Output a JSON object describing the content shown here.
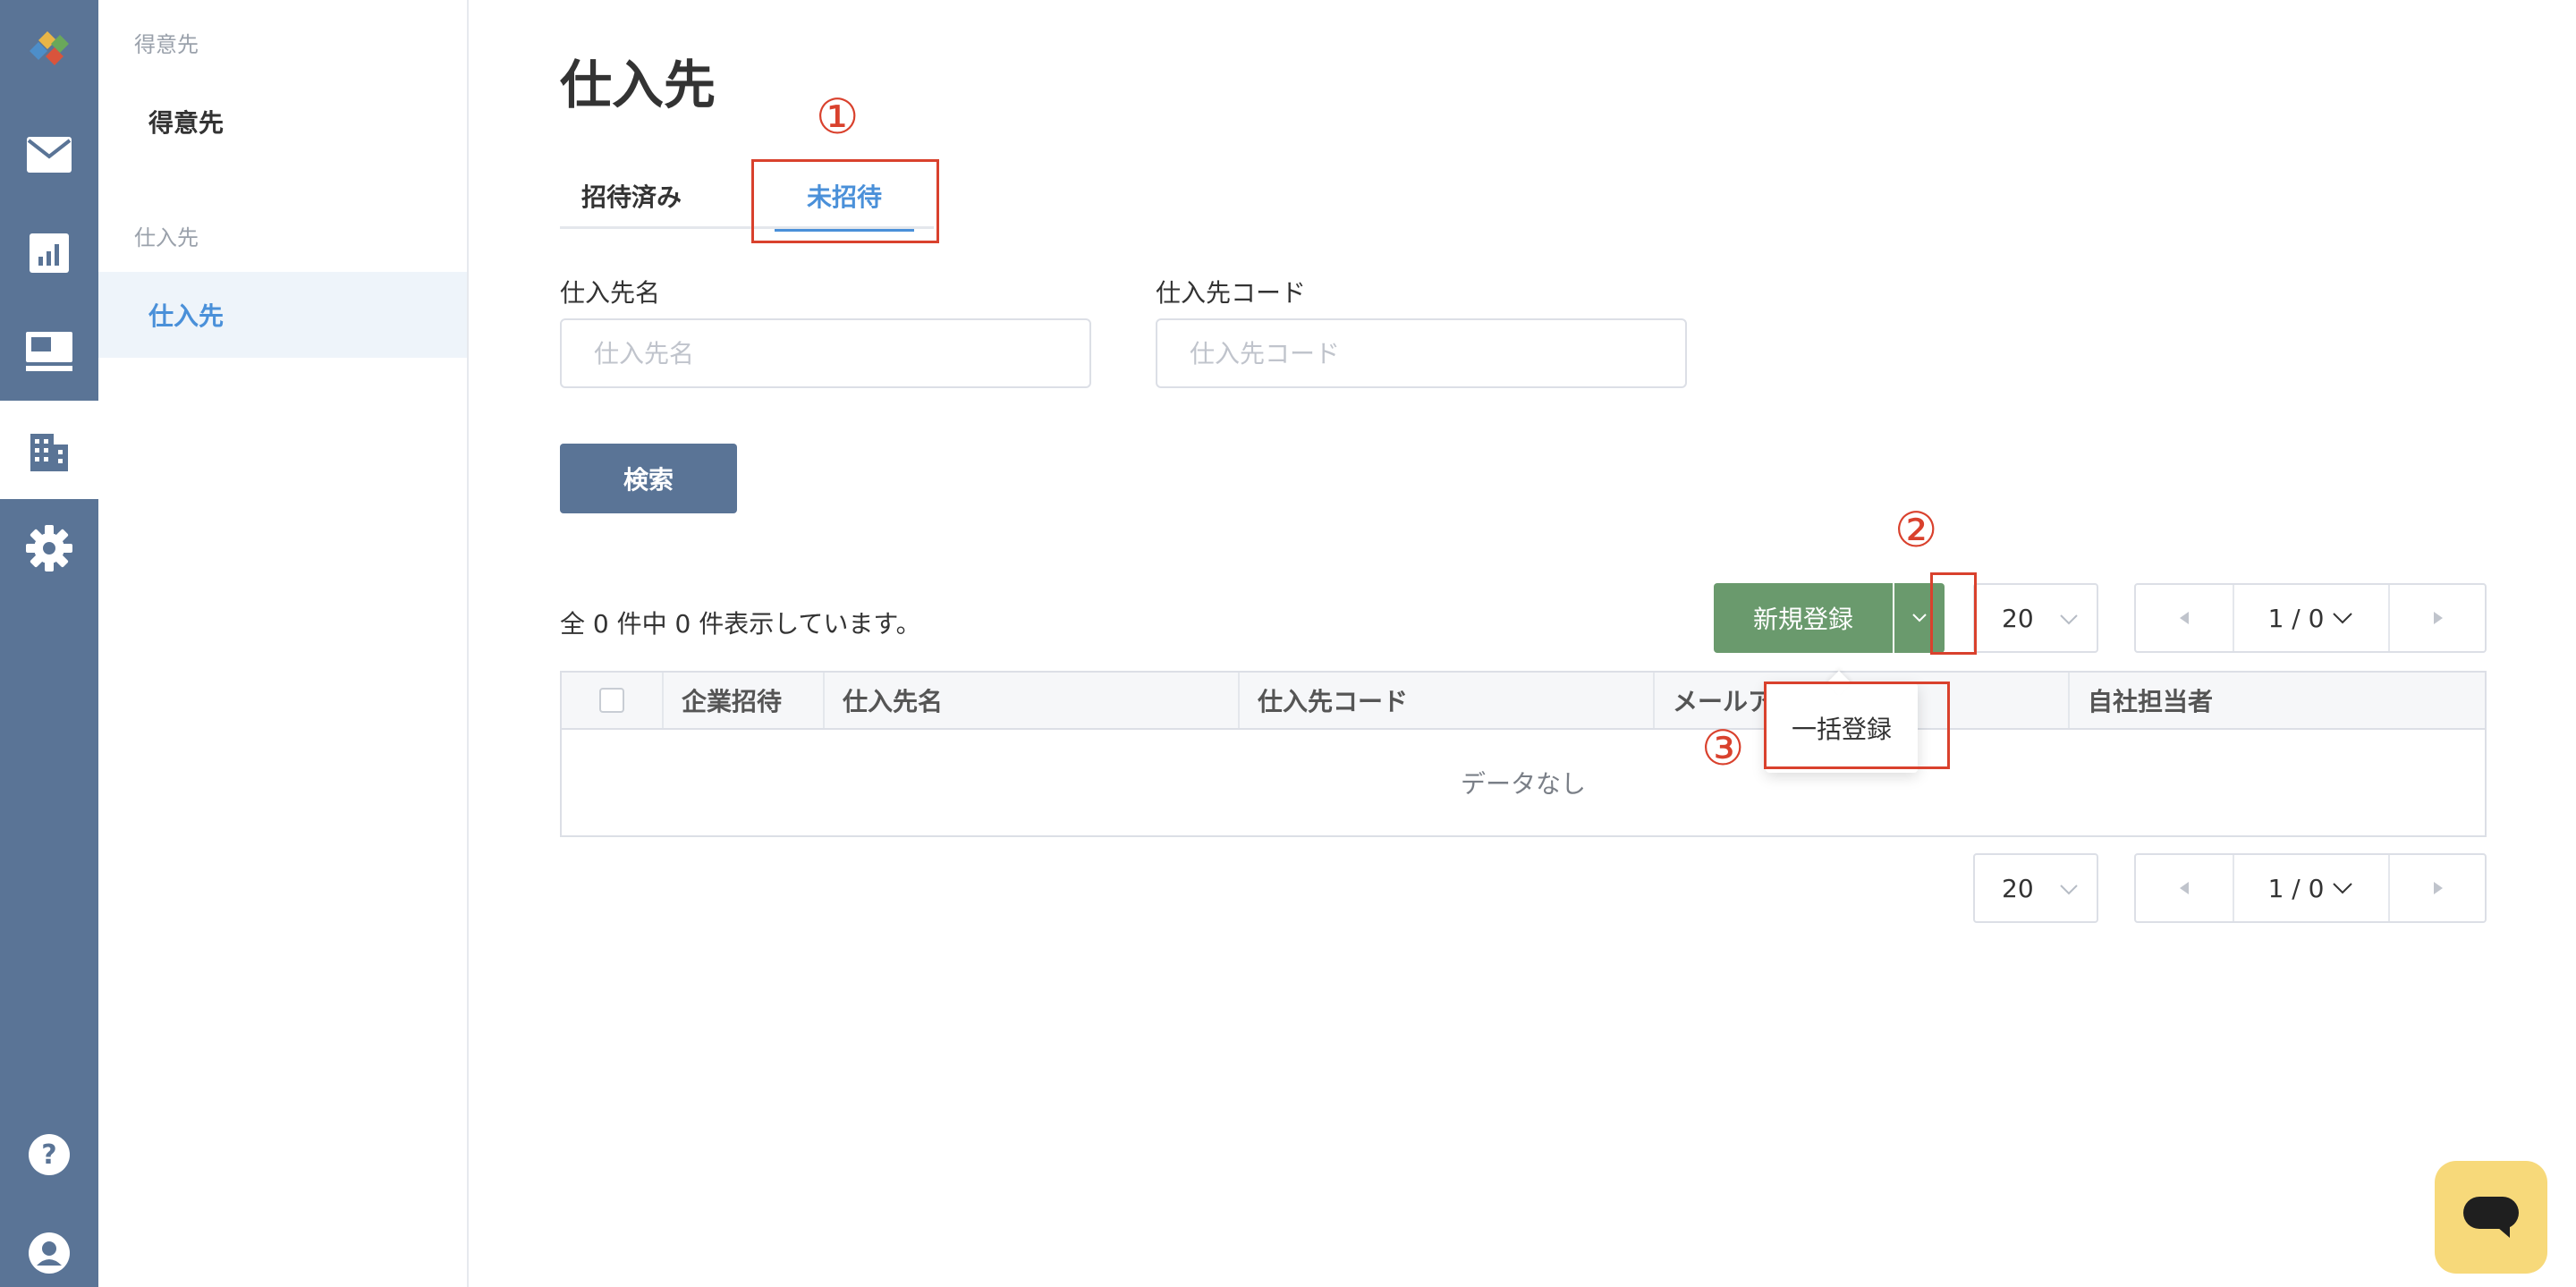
{
  "rail": {
    "items": [
      {
        "icon": "logo-icon"
      },
      {
        "icon": "mail-icon"
      },
      {
        "icon": "chart-icon"
      },
      {
        "icon": "invoice-icon"
      },
      {
        "icon": "building-icon",
        "active": true
      },
      {
        "icon": "gear-icon"
      },
      {
        "icon": "help-icon"
      },
      {
        "icon": "user-icon"
      }
    ]
  },
  "sidebar": {
    "group1": "得意先",
    "item1": "得意先",
    "group2": "仕入先",
    "item2": "仕入先"
  },
  "page": {
    "title": "仕入先",
    "tabs": [
      "招待済み",
      "未招待"
    ],
    "active_tab": "未招待"
  },
  "search": {
    "name_label": "仕入先名",
    "name_placeholder": "仕入先名",
    "name_value": "",
    "code_label": "仕入先コード",
    "code_placeholder": "仕入先コード",
    "code_value": "",
    "button": "検索"
  },
  "list": {
    "count_text": "全 0 件中 0 件表示しています。",
    "new_button": "新規登録",
    "dropdown_item": "一括登録",
    "page_size": "20",
    "page_indicator": "1 / 0",
    "empty_text": "データなし"
  },
  "table": {
    "columns": [
      "企業招待",
      "仕入先名",
      "仕入先コード",
      "メールアドレス",
      "自社担当者"
    ]
  },
  "annotations": {
    "one": "①",
    "two": "②",
    "three": "③"
  },
  "colors": {
    "rail": "#5a7496",
    "accent": "#4a90d9",
    "primary_button": "#6a9a6d",
    "annotation": "#d9412d",
    "chat": "#f7d97a"
  }
}
